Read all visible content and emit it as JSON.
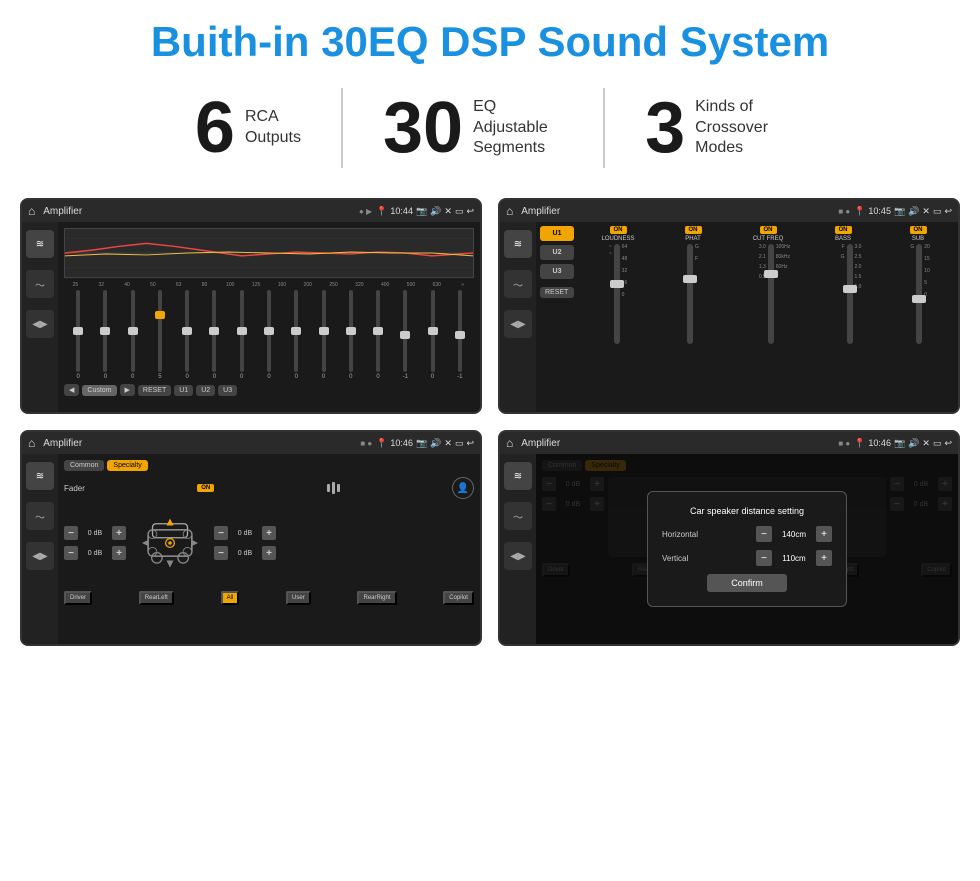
{
  "header": {
    "title": "Buith-in 30EQ DSP Sound System"
  },
  "stats": [
    {
      "number": "6",
      "label_line1": "RCA",
      "label_line2": "Outputs"
    },
    {
      "number": "30",
      "label_line1": "EQ Adjustable",
      "label_line2": "Segments"
    },
    {
      "number": "3",
      "label_line1": "Kinds of",
      "label_line2": "Crossover Modes"
    }
  ],
  "screens": [
    {
      "id": "eq-screen",
      "topbar": {
        "title": "Amplifier",
        "time": "10:44"
      },
      "type": "eq",
      "freqs": [
        "25",
        "32",
        "40",
        "50",
        "63",
        "80",
        "100",
        "125",
        "160",
        "200",
        "250",
        "320",
        "400",
        "500",
        "630"
      ],
      "values": [
        "0",
        "0",
        "0",
        "5",
        "0",
        "0",
        "0",
        "0",
        "0",
        "0",
        "0",
        "0",
        "-1",
        "0",
        "-1"
      ],
      "buttons": [
        "Custom",
        "RESET",
        "U1",
        "U2",
        "U3"
      ]
    },
    {
      "id": "crossover-screen",
      "topbar": {
        "title": "Amplifier",
        "time": "10:45"
      },
      "type": "crossover",
      "presets": [
        "U1",
        "U2",
        "U3"
      ],
      "channels": [
        {
          "on": true,
          "label": "LOUDNESS"
        },
        {
          "on": true,
          "label": "PHAT"
        },
        {
          "on": true,
          "label": "CUT FREQ"
        },
        {
          "on": true,
          "label": "BASS"
        },
        {
          "on": true,
          "label": "SUB"
        }
      ]
    },
    {
      "id": "fader-screen",
      "topbar": {
        "title": "Amplifier",
        "time": "10:46"
      },
      "type": "fader",
      "tabs": [
        "Common",
        "Specialty"
      ],
      "fader_label": "Fader",
      "fader_on": "ON",
      "speaker_controls": [
        {
          "label": "0 dB"
        },
        {
          "label": "0 dB"
        },
        {
          "label": "0 dB"
        },
        {
          "label": "0 dB"
        }
      ],
      "bottom_btns": [
        "Driver",
        "RearLeft",
        "All",
        "User",
        "RearRight",
        "Copilot"
      ]
    },
    {
      "id": "dialog-screen",
      "topbar": {
        "title": "Amplifier",
        "time": "10:46"
      },
      "type": "dialog",
      "tabs": [
        "Common",
        "Specialty"
      ],
      "dialog": {
        "title": "Car speaker distance setting",
        "rows": [
          {
            "label": "Horizontal",
            "value": "140cm"
          },
          {
            "label": "Vertical",
            "value": "110cm"
          }
        ],
        "confirm_label": "Confirm"
      },
      "right_controls": [
        {
          "label": "0 dB"
        },
        {
          "label": "0 dB"
        }
      ]
    }
  ]
}
